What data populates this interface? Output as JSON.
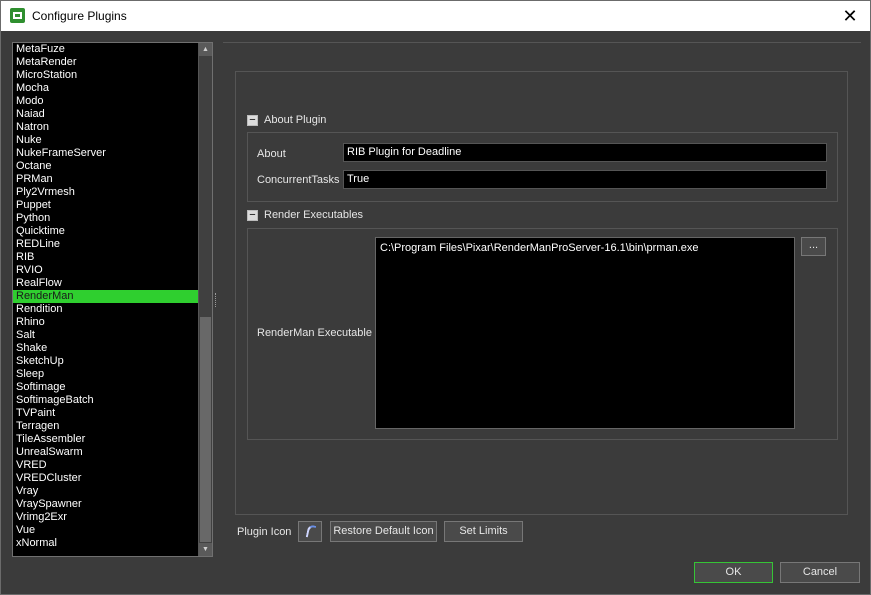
{
  "window": {
    "title": "Configure Plugins",
    "close_glyph": "✕"
  },
  "plugin_list": {
    "items": [
      "MetaFuze",
      "MetaRender",
      "MicroStation",
      "Mocha",
      "Modo",
      "Naiad",
      "Natron",
      "Nuke",
      "NukeFrameServer",
      "Octane",
      "PRMan",
      "Ply2Vrmesh",
      "Puppet",
      "Python",
      "Quicktime",
      "REDLine",
      "RIB",
      "RVIO",
      "RealFlow",
      "RenderMan",
      "Rendition",
      "Rhino",
      "Salt",
      "Shake",
      "SketchUp",
      "Sleep",
      "Softimage",
      "SoftimageBatch",
      "TVPaint",
      "Terragen",
      "TileAssembler",
      "UnrealSwarm",
      "VRED",
      "VREDCluster",
      "Vray",
      "VraySpawner",
      "Vrimg2Exr",
      "Vue",
      "xNormal"
    ],
    "selected": "RenderMan",
    "selected_color": "#2fcf2f"
  },
  "about_section": {
    "title": "About Plugin",
    "collapse_glyph": "−",
    "about_label": "About",
    "about_value": "RIB Plugin for Deadline",
    "concurrent_label": "ConcurrentTasks",
    "concurrent_value": "True"
  },
  "render_section": {
    "title": "Render Executables",
    "collapse_glyph": "−",
    "executable_label": "RenderMan Executable",
    "executable_value": "C:\\Program Files\\Pixar\\RenderManProServer-16.1\\bin\\prman.exe",
    "browse_label": "..."
  },
  "bottom": {
    "plugin_icon_label": "Plugin Icon",
    "restore_label": "Restore Default Icon",
    "set_limits_label": "Set Limits",
    "ok_label": "OK",
    "cancel_label": "Cancel"
  },
  "icons": {
    "app": "deadline-monitor-icon",
    "plugin": "renderman-quill-icon"
  },
  "colors": {
    "ok_border": "#36c436",
    "background": "#3b3b3b"
  }
}
